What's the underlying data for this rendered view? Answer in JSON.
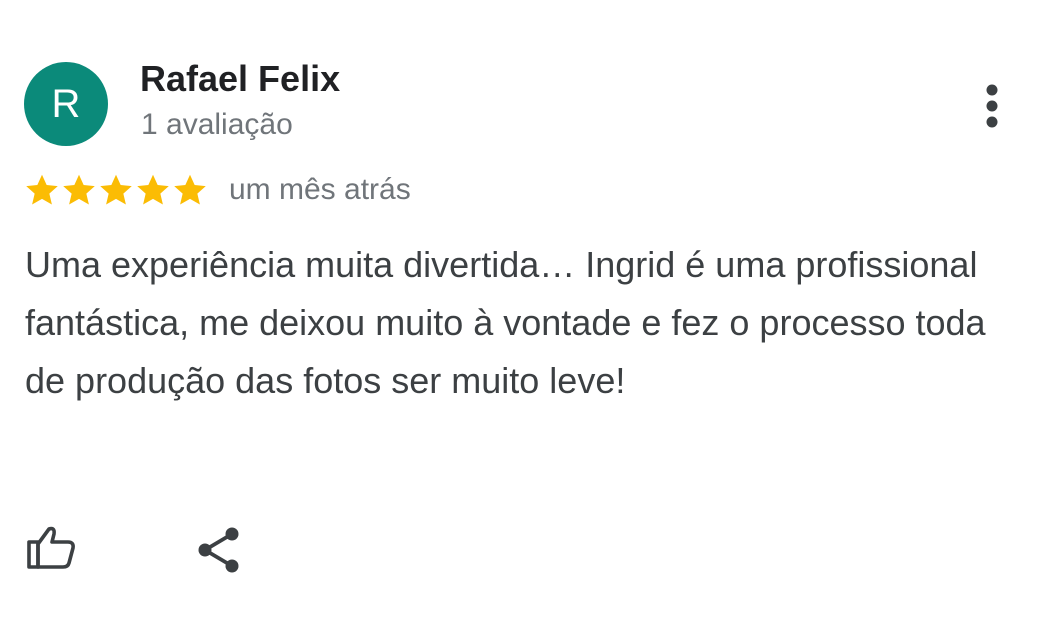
{
  "reviewer": {
    "initial": "R",
    "name": "Rafael Felix",
    "review_count": "1 avaliação",
    "avatar_color": "#0b8a7a"
  },
  "rating": {
    "stars": 5,
    "max_stars": 5,
    "star_color": "#fbbc04",
    "date": "um mês atrás"
  },
  "review": {
    "text": "Uma experiência muita divertida… Ingrid é uma profissional fantástica, me deixou muito à vontade e fez o processo toda de produção das fotos ser muito leve!"
  },
  "actions": {
    "more_icon": "more-vertical-icon",
    "like_icon": "thumbs-up-icon",
    "share_icon": "share-icon"
  }
}
